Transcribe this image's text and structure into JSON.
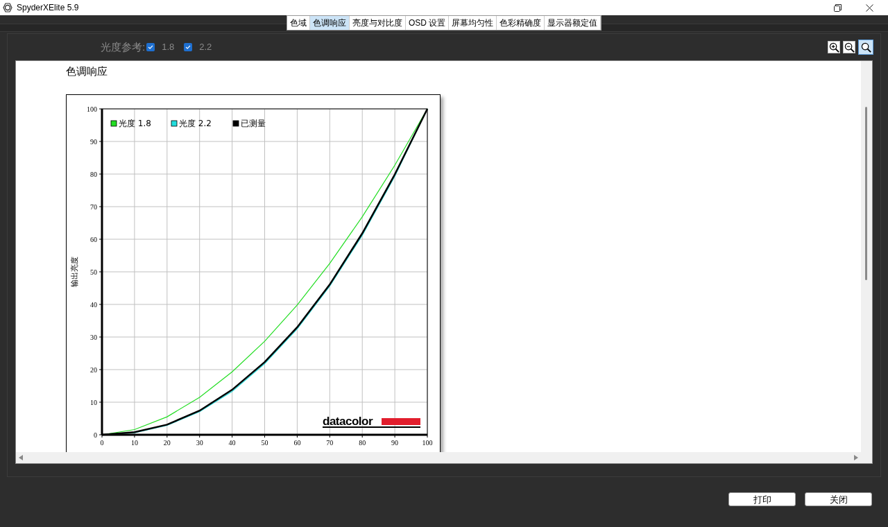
{
  "window": {
    "title": "SpyderXElite 5.9"
  },
  "tabs": [
    {
      "label": "色域",
      "selected": false
    },
    {
      "label": "色调响应",
      "selected": true
    },
    {
      "label": "亮度与对比度",
      "selected": false
    },
    {
      "label": "OSD 设置",
      "selected": false
    },
    {
      "label": "屏幕均匀性",
      "selected": false
    },
    {
      "label": "色彩精确度",
      "selected": false
    },
    {
      "label": "显示器额定值",
      "selected": false
    }
  ],
  "gamma_reference": {
    "label": "光度参考:",
    "options": [
      {
        "label": "1.8",
        "checked": true
      },
      {
        "label": "2.2",
        "checked": true
      }
    ]
  },
  "zoom_tools": [
    {
      "kind": "zoom-in",
      "selected": false
    },
    {
      "kind": "zoom-out",
      "selected": false
    },
    {
      "kind": "zoom-fit",
      "selected": true
    }
  ],
  "report": {
    "title": "色调响应",
    "logo": "datacolor",
    "chart_data": {
      "type": "line",
      "ylabel": "输出亮度",
      "grid": true,
      "legend": true,
      "x": [
        0,
        10,
        20,
        30,
        40,
        50,
        60,
        70,
        80,
        90,
        100
      ],
      "xlim": [
        0,
        100
      ],
      "ylim": [
        0,
        100
      ],
      "xticks": [
        0,
        10,
        20,
        30,
        40,
        50,
        60,
        70,
        80,
        90,
        100
      ],
      "yticks": [
        0,
        10,
        20,
        30,
        40,
        50,
        60,
        70,
        80,
        90,
        100
      ],
      "series": [
        {
          "name": "光度 1.8",
          "color": "#22dd22",
          "values": [
            0,
            1.6,
            5.5,
            11.5,
            19.3,
            28.7,
            39.8,
            52.6,
            66.9,
            82.7,
            100
          ]
        },
        {
          "name": "光度 2.2",
          "color": "#22dddd",
          "values": [
            0,
            0.6,
            2.9,
            7.1,
            13.3,
            21.8,
            32.5,
            45.6,
            61.2,
            79.3,
            100
          ]
        },
        {
          "name": "已测量",
          "color": "#000000",
          "values": [
            0,
            0.8,
            3.1,
            7.4,
            13.8,
            22.3,
            33.0,
            46.1,
            61.8,
            79.9,
            100
          ]
        }
      ]
    }
  },
  "buttons": [
    "打印",
    "关闭"
  ]
}
